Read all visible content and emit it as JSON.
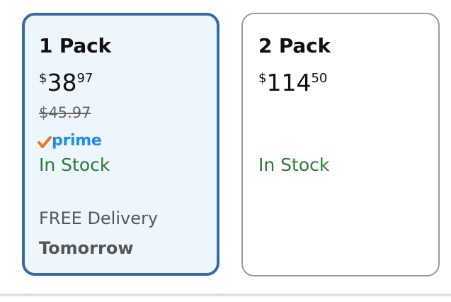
{
  "options": [
    {
      "title": "1 Pack",
      "price": {
        "currency": "$",
        "whole": "38",
        "fraction": "97"
      },
      "list_price": "$45.97",
      "prime_label": "prime",
      "availability": "In Stock",
      "delivery_label": "FREE Delivery",
      "delivery_date": "Tomorrow",
      "selected": true
    },
    {
      "title": "2 Pack",
      "price": {
        "currency": "$",
        "whole": "114",
        "fraction": "50"
      },
      "availability": "In Stock",
      "selected": false
    }
  ],
  "colors": {
    "selected_border": "#3a6aa3",
    "selected_background": "#eef6fd",
    "unselected_border": "#9a9a9a",
    "in_stock": "#2c7a34",
    "prime_blue": "#1f8fe6",
    "prime_check": "#f0731f"
  },
  "icons": {
    "prime_check": "prime-check-icon"
  }
}
